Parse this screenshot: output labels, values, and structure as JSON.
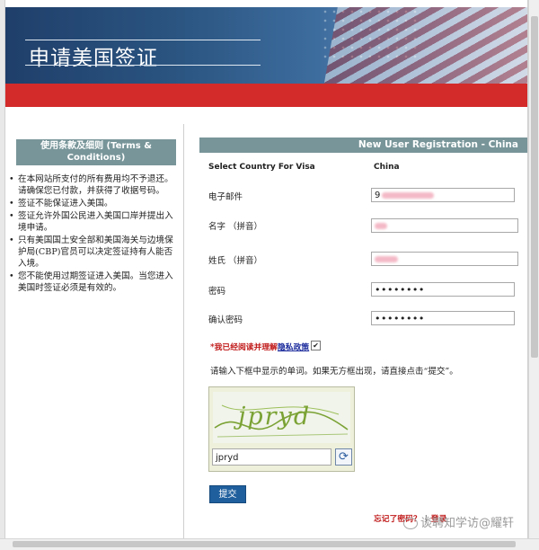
{
  "banner": {
    "title": "申请美国签证"
  },
  "sidebar": {
    "heading": "使用条款及细则 (Terms & Conditions)",
    "terms": [
      "在本网站所支付的所有费用均不予退还。请确保您已付款，并获得了收据号码。",
      "签证不能保证进入美国。",
      "签证允许外国公民进入美国口岸并提出入境申请。",
      "只有美国国土安全部和美国海关与边境保护局(CBP)官员可以决定签证持有人能否入境。",
      "您不能使用过期签证进入美国。当您进入美国时签证必须是有效的。"
    ]
  },
  "form": {
    "heading": "New User Registration - China",
    "country_label": "Select Country For Visa",
    "country_value": "China",
    "email_label": "电子邮件",
    "email_value": "9",
    "given_name_label": "名字 （拼音）",
    "surname_label": "姓氏 （拼音）",
    "password_label": "密码",
    "password_value": "••••••••",
    "confirm_label": "确认密码",
    "confirm_value": "••••••••",
    "agree_text": "*我已经阅读并理解",
    "privacy_link": "隐私政策",
    "instructions": "请输入下框中显示的单词。如果无方框出现，请直接点击“提交”。",
    "captcha_word": "jpryd",
    "captcha_input": "jpryd",
    "submit_label": "提交",
    "forgot_password": "忘记了密码？",
    "login": "登录"
  },
  "watermark": "谈聘知学访@耀轩",
  "colors": {
    "header_band": "#78969a",
    "red_bar": "#d32a2a",
    "submit": "#1f5f9e"
  }
}
